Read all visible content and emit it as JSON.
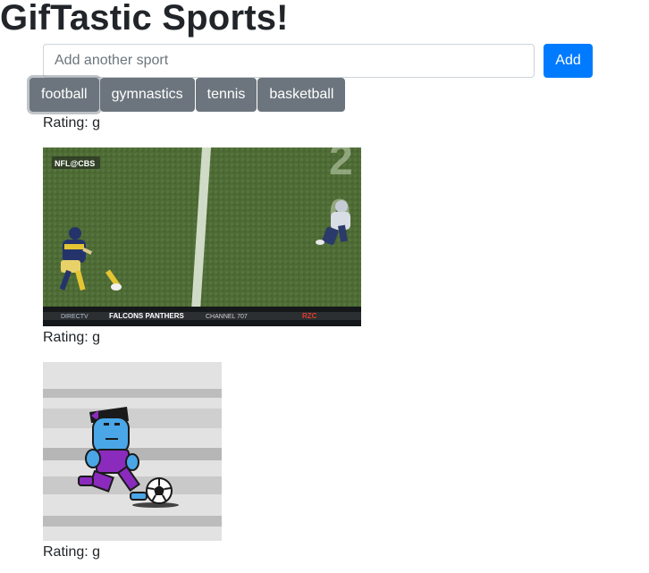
{
  "page": {
    "title": "GifTastic Sports!"
  },
  "form": {
    "placeholder": "Add another sport",
    "add_label": "Add"
  },
  "sports": [
    "football",
    "gymnastics",
    "tennis",
    "basketball"
  ],
  "gifs": [
    {
      "rating_label": "Rating: g",
      "scoreboard": "FALCONS  PANTHERS",
      "channel": "CHANNEL 707",
      "network": "NFL@CBS",
      "score_badge": "RZC",
      "watermark": "DIRECTV"
    },
    {
      "rating_label": "Rating: g"
    },
    {
      "rating_label": "Rating: g"
    }
  ],
  "colors": {
    "primary": "#007bff",
    "secondary": "#6c757d",
    "field_green": "#4e6b34"
  },
  "icons": [
    "football-player-gif",
    "soccer-kid-gif"
  ]
}
